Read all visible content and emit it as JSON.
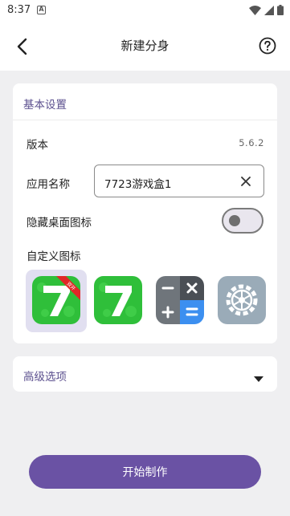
{
  "status_bar": {
    "time": "8:37",
    "notification_letter": "A"
  },
  "app_bar": {
    "title": "新建分身"
  },
  "basic_settings": {
    "section_title": "基本设置",
    "version_label": "版本",
    "version_value": "5.6.2",
    "app_name_label": "应用名称",
    "app_name_value": "7723游戏盒1",
    "hide_icon_label": "隐藏桌面图标",
    "hide_icon_toggle_on": false,
    "custom_icon_label": "自定义图标",
    "icon_badge_text": "双开",
    "icons": [
      "7723-badge-icon",
      "7723-icon",
      "calculator-icon",
      "settings-gear-icon"
    ],
    "selected_icon_index": 0
  },
  "advanced": {
    "label": "高级选项"
  },
  "actions": {
    "start_label": "开始制作"
  },
  "colors": {
    "accent": "#6a52a4",
    "section_text": "#5b4f8e",
    "app_green": "#2fbf3a"
  }
}
